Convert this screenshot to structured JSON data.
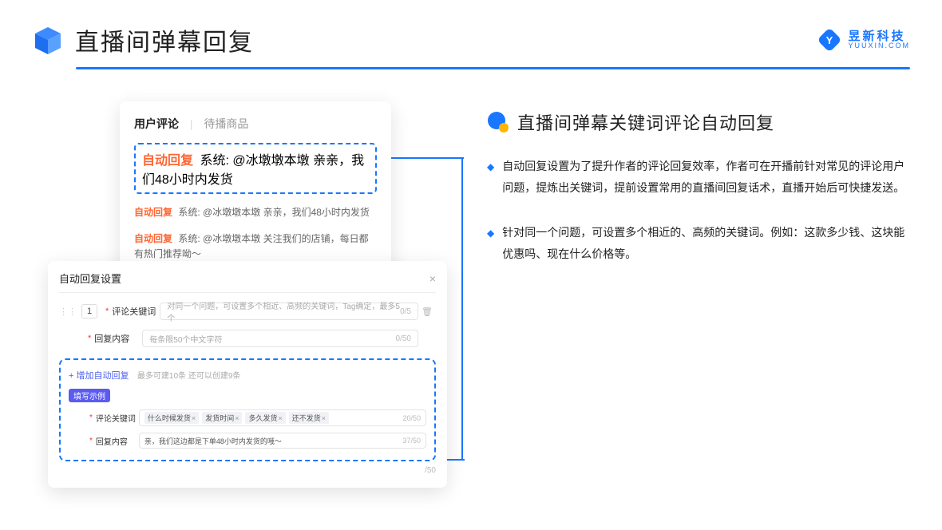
{
  "header": {
    "title": "直播间弹幕回复",
    "brand_cn": "昱新科技",
    "brand_en": "YUUXIN.COM"
  },
  "tabs": {
    "t1": "用户评论",
    "t2": "待播商品"
  },
  "comments": {
    "auto_label": "自动回复",
    "sys_label": "系统:",
    "c1": "@冰墩墩本墩 亲亲，我们48小时内发货",
    "c2": "@冰墩墩本墩 亲亲，我们48小时内发货",
    "c3": "@冰墩墩本墩 关注我们的店铺，每日都有热门推荐呦～"
  },
  "settings": {
    "title": "自动回复设置",
    "order": "1",
    "kw_label": "评论关键词",
    "kw_ph": "对同一个问题，可设置多个相近、高频的关键词，Tag确定，最多5个",
    "kw_count": "0/5",
    "reply_label": "回复内容",
    "reply_ph": "每条限50个中文字符",
    "reply_count": "0/50",
    "add": "+ 增加自动回复",
    "add_hint": "最多可建10条 还可以创建9条",
    "badge": "填写示例",
    "ex_kw_label": "评论关键词",
    "ex_tags": [
      "什么时候发货",
      "发货时间",
      "多久发货",
      "还不发货"
    ],
    "ex_kw_count": "20/50",
    "ex_reply_label": "回复内容",
    "ex_reply_text": "亲，我们这边都是下单48小时内发货的哦～",
    "ex_reply_count": "37/50",
    "bottom_count": "/50"
  },
  "right": {
    "title": "直播间弹幕关键词评论自动回复",
    "b1": "自动回复设置为了提升作者的评论回复效率，作者可在开播前针对常见的评论用户问题，提炼出关键词，提前设置常用的直播间回复话术，直播开始后可快捷发送。",
    "b2": "针对同一个问题，可设置多个相近的、高频的关键词。例如：这款多少钱、这块能优惠吗、现在什么价格等。"
  }
}
